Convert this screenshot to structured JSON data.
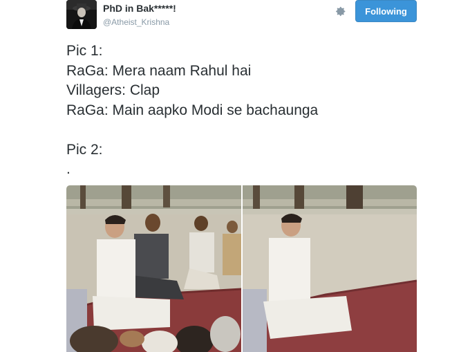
{
  "user": {
    "display_name": "PhD in Bak*****!",
    "handle": "@Atheist_Krishna"
  },
  "actions": {
    "follow_label": "Following",
    "gear_icon": "gear-icon"
  },
  "tweet": {
    "lines": [
      "Pic 1:",
      "RaGa: Mera naam Rahul hai",
      "Villagers: Clap",
      "RaGa: Main aapko Modi se bachaunga",
      "",
      "Pic 2:",
      "."
    ]
  },
  "media": {
    "photo_count": 2
  },
  "colors": {
    "accent": "#3b94d9",
    "text": "#292f33",
    "muted": "#8899a6"
  }
}
